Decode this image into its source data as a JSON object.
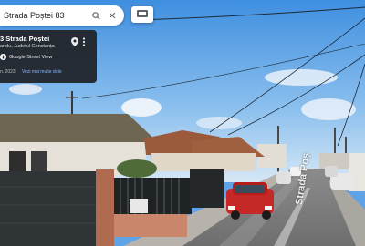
{
  "search": {
    "value": "Strada Poștei 83"
  },
  "info_card": {
    "title": "3 Strada Poștei",
    "subtitle": "andu, Județul Constanța",
    "provider": "Google Street View",
    "date": "n. 2023",
    "more_dates": "Vezi mai multe date"
  },
  "street_label": "Strada Poș",
  "icons": {
    "search": "search-icon",
    "close": "close-icon",
    "layers": "layers-icon",
    "pin": "location-pin-icon",
    "more": "more-vert-icon",
    "street_view": "street-view-icon"
  },
  "colors": {
    "sky": "#5fa3e6",
    "card_bg": "#202124",
    "link": "#8ab4f8",
    "car": "#d32f2f"
  }
}
